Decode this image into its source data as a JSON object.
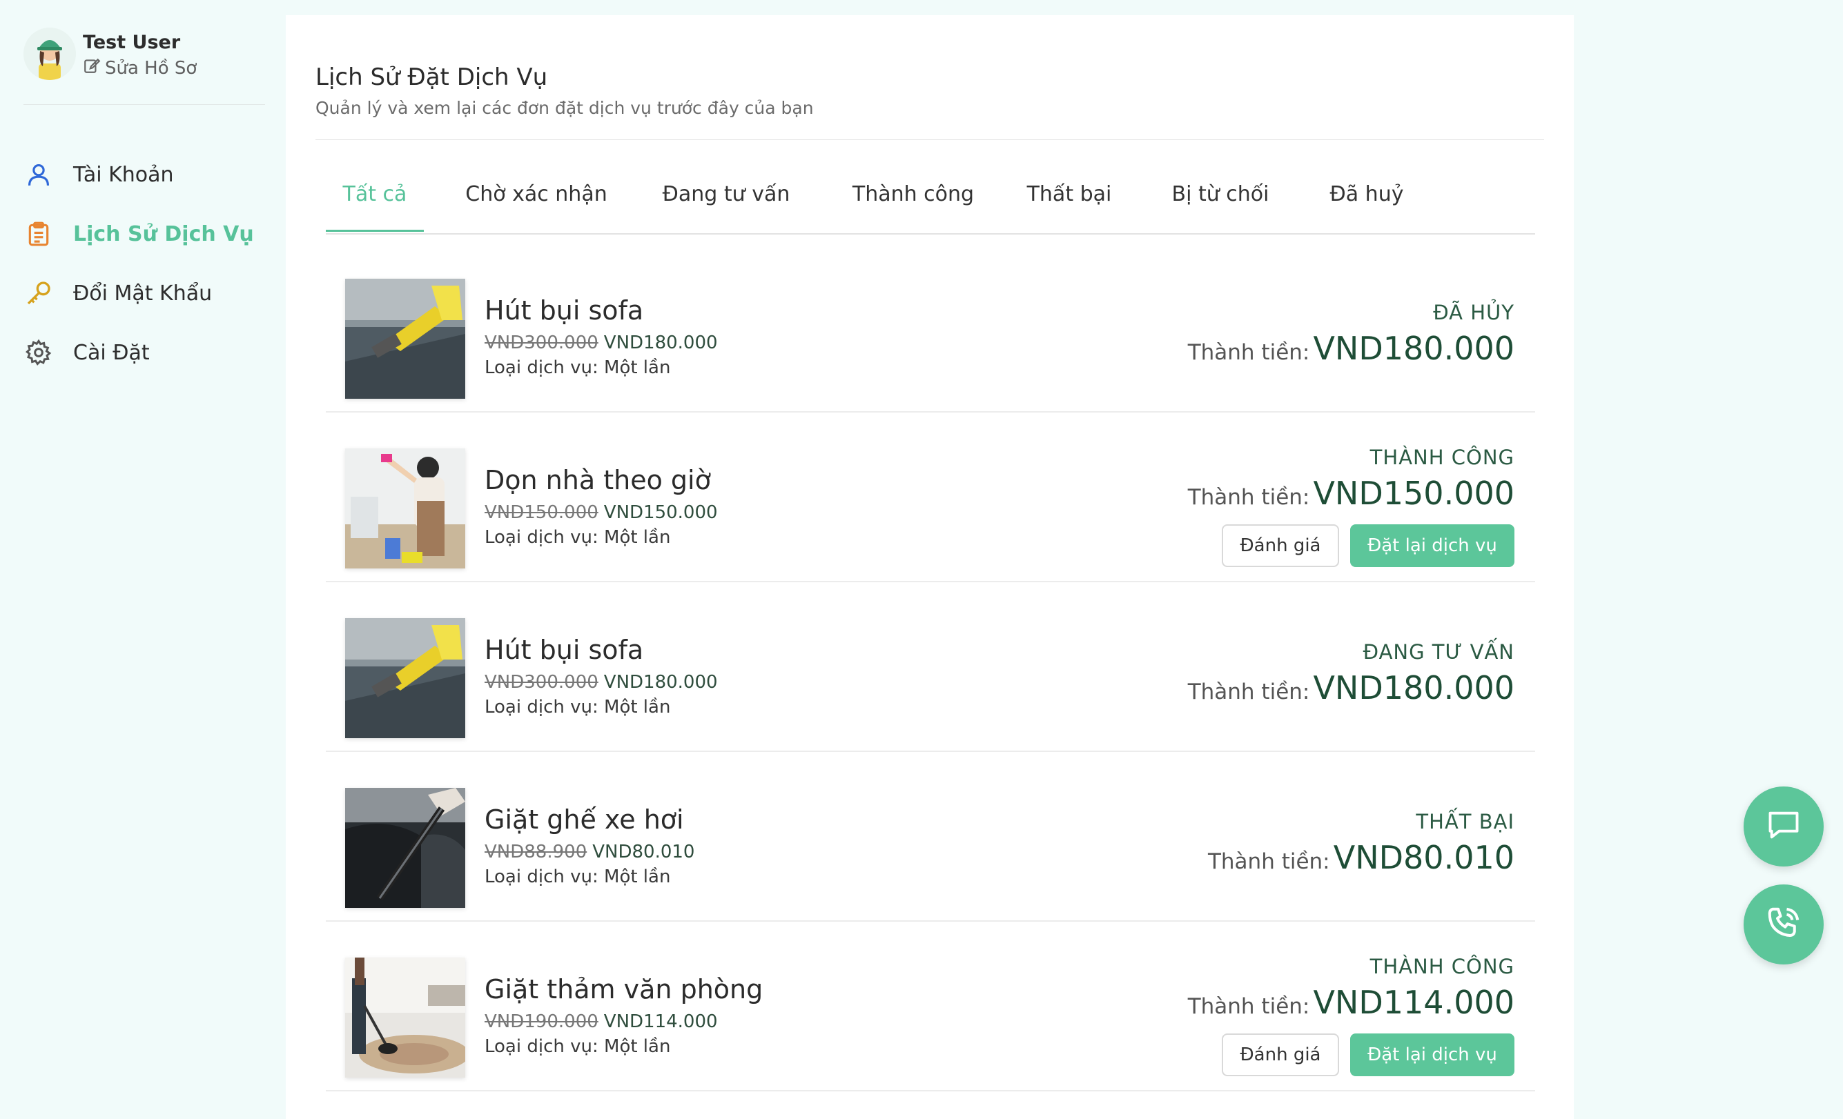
{
  "profile": {
    "name": "Test User",
    "edit_label": "Sửa Hồ Sơ"
  },
  "nav": [
    {
      "label": "Tài Khoản",
      "icon": "user-icon",
      "active": false
    },
    {
      "label": "Lịch Sử Dịch Vụ",
      "icon": "clipboard-icon",
      "active": true
    },
    {
      "label": "Đổi Mật Khẩu",
      "icon": "key-icon",
      "active": false
    },
    {
      "label": "Cài Đặt",
      "icon": "gear-icon",
      "active": false
    }
  ],
  "header": {
    "title": "Lịch Sử Đặt Dịch Vụ",
    "subtitle": "Quản lý và xem lại các đơn đặt dịch vụ trước đây của bạn"
  },
  "tabs": [
    "Tất cả",
    "Chờ xác nhận",
    "Đang tư vấn",
    "Thành công",
    "Thất bại",
    "Bị từ chối",
    "Đã huỷ"
  ],
  "orders": [
    {
      "name": "Hút bụi sofa",
      "old_price": "VND300.000",
      "price": "VND180.000",
      "type": "Loại dịch vụ: Một lần",
      "status": "ĐÃ HỦY",
      "total_label": "Thành tiền:",
      "total": "VND180.000"
    },
    {
      "name": "Dọn nhà theo giờ",
      "old_price": "VND150.000",
      "price": "VND150.000",
      "type": "Loại dịch vụ: Một lần",
      "status": "THÀNH CÔNG",
      "total_label": "Thành tiền:",
      "total": "VND150.000",
      "rate_label": "Đánh giá",
      "rebook_label": "Đặt lại dịch vụ"
    },
    {
      "name": "Hút bụi sofa",
      "old_price": "VND300.000",
      "price": "VND180.000",
      "type": "Loại dịch vụ: Một lần",
      "status": "ĐANG TƯ VẤN",
      "total_label": "Thành tiền:",
      "total": "VND180.000"
    },
    {
      "name": "Giặt ghế xe hơi",
      "old_price": "VND88.900",
      "price": "VND80.010",
      "type": "Loại dịch vụ: Một lần",
      "status": "THẤT BẠI",
      "total_label": "Thành tiền:",
      "total": "VND80.010"
    },
    {
      "name": "Giặt thảm văn phòng",
      "old_price": "VND190.000",
      "price": "VND114.000",
      "type": "Loại dịch vụ: Một lần",
      "status": "THÀNH CÔNG",
      "total_label": "Thành tiền:",
      "total": "VND114.000",
      "rate_label": "Đánh giá",
      "rebook_label": "Đặt lại dịch vụ"
    }
  ],
  "colors": {
    "accent": "#5cc69a",
    "background": "#f1fbfa",
    "status_text": "#2b5a43"
  },
  "fabs": [
    "chat-icon",
    "phone-icon"
  ]
}
